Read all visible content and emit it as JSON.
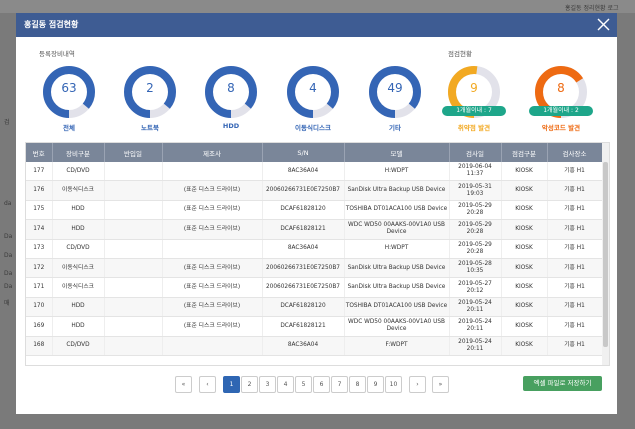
{
  "background": {
    "top_right_text": "홍길동 정리현황 로그",
    "left_fragments": [
      "검",
      "da",
      "Da",
      "Da",
      "Da",
      "Da",
      "매"
    ]
  },
  "modal": {
    "title": "홍길동 점검현황",
    "section_left": "등록장비내역",
    "section_right": "점검현황",
    "donuts_registered": [
      {
        "value": "63",
        "label": "전체",
        "fraction": 0.86
      },
      {
        "value": "2",
        "label": "노트북",
        "fraction": 0.86
      },
      {
        "value": "8",
        "label": "HDD",
        "fraction": 0.86
      },
      {
        "value": "4",
        "label": "이동식디스크",
        "fraction": 0.86
      },
      {
        "value": "49",
        "label": "기타",
        "fraction": 0.86
      }
    ],
    "donuts_status": [
      {
        "value": "9",
        "label": "취약점 발견",
        "pill": "1개월이내 : 7",
        "color": "#f2a922",
        "fraction": 0.52
      },
      {
        "value": "8",
        "label": "악성코드 발견",
        "pill": "1개월이내 : 2",
        "color": "#ee6a12",
        "fraction": 0.66
      }
    ]
  },
  "table": {
    "headers": [
      "번호",
      "장비구분",
      "반입일",
      "제조사",
      "S/N",
      "모델",
      "검사일",
      "점검구분",
      "검사장소"
    ],
    "rows": [
      [
        "177",
        "CD/DVD",
        "",
        "",
        "8AC36A04",
        "H:WDPT",
        "2019-06-04 11:37",
        "KIOSK",
        "기흥 H1"
      ],
      [
        "176",
        "이동식디스크",
        "",
        "(표준 디스크 드라이브)",
        "20060266731E0E7250B7",
        "SanDisk Ultra Backup USB Device",
        "2019-05-31 19:03",
        "KIOSK",
        "기흥 H1"
      ],
      [
        "175",
        "HDD",
        "",
        "(표준 디스크 드라이브)",
        "DCAF61828120",
        "TOSHIBA DT01ACA100 USB Device",
        "2019-05-29 20:28",
        "KIOSK",
        "기흥 H1"
      ],
      [
        "174",
        "HDD",
        "",
        "(표준 디스크 드라이브)",
        "DCAF61828121",
        "WDC WD50 00AAKS-00V1A0 USB Device",
        "2019-05-29 20:28",
        "KIOSK",
        "기흥 H1"
      ],
      [
        "173",
        "CD/DVD",
        "",
        "",
        "8AC36A04",
        "H:WDPT",
        "2019-05-29 20:28",
        "KIOSK",
        "기흥 H1"
      ],
      [
        "172",
        "이동식디스크",
        "",
        "(표준 디스크 드라이브)",
        "20060266731E0E7250B7",
        "SanDisk Ultra Backup USB Device",
        "2019-05-28 10:35",
        "KIOSK",
        "기흥 H1"
      ],
      [
        "171",
        "이동식디스크",
        "",
        "(표준 디스크 드라이브)",
        "20060266731E0E7250B7",
        "SanDisk Ultra Backup USB Device",
        "2019-05-27 20:12",
        "KIOSK",
        "기흥 H1"
      ],
      [
        "170",
        "HDD",
        "",
        "(표준 디스크 드라이브)",
        "DCAF61828120",
        "TOSHIBA DT01ACA100 USB Device",
        "2019-05-24 20:11",
        "KIOSK",
        "기흥 H1"
      ],
      [
        "169",
        "HDD",
        "",
        "(표준 디스크 드라이브)",
        "DCAF61828121",
        "WDC WD50 00AAKS-00V1A0 USB Device",
        "2019-05-24 20:11",
        "KIOSK",
        "기흥 H1"
      ],
      [
        "168",
        "CD/DVD",
        "",
        "",
        "8AC36A04",
        "F:WDPT",
        "2019-05-24 20:11",
        "KIOSK",
        "기흥 H1"
      ]
    ]
  },
  "pagination": {
    "first": "«",
    "prev": "‹",
    "next": "›",
    "last": "»",
    "pages": [
      "1",
      "2",
      "3",
      "4",
      "5",
      "6",
      "7",
      "8",
      "9",
      "10"
    ],
    "current": "1"
  },
  "excel_button": "엑셀 파일로 저장하기",
  "colors": {
    "header": "#3e5c93",
    "donut_blue": "#3465b5",
    "donut_track": "#e2e2ea",
    "pill": "#1ea68a",
    "excel": "#48a060",
    "table_header": "#7a8699"
  },
  "icons": {
    "close": "close-icon"
  }
}
